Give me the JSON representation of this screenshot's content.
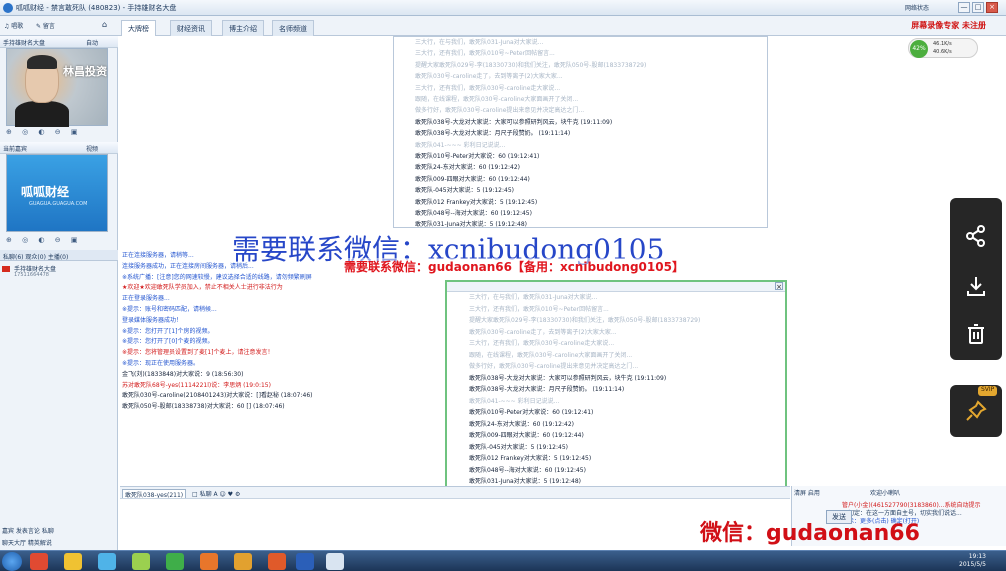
{
  "window": {
    "title": "呱呱财经 - 禁言敢死队 (480823) - 手持雄财名大盘",
    "status_right": "网络状态",
    "minimize": "—",
    "maximize": "□",
    "close": "×"
  },
  "toolbar": {
    "left_items": [
      "♫ 唱歌",
      "✎ 留言",
      "⌂"
    ],
    "tabs": [
      "大牌榜",
      "财经资讯",
      "博主介绍",
      "名师频道"
    ],
    "promo": "屏幕录像专家 未注册"
  },
  "left": {
    "sec1": "手持雄财名大盘",
    "sec1_right": "自动",
    "video1_text": "林昌投资",
    "video2_big": "呱呱财经",
    "video2_small": "GUAGUA.GUAGUA.COM",
    "sec2": "当前嘉宾",
    "sec2_right": "视频",
    "ctrl_row": "⊕ ◎ ◐ ⊖ ▣",
    "userlist_tabs": "私聊(6) 观众(0) 主播(0)",
    "user1": "手持雄财名大盘",
    "user1_sub": "17511664478",
    "bottom1": "嘉宾   发表言论   私聊",
    "bottom2": "聊天大厅   精英解说"
  },
  "chat_top": [
    {
      "text": "三大行，在与我们，敢死队031-Juna对大家说...",
      "faded": true
    },
    {
      "text": "三大行，还有我们，敢死队010号~Peter回帖留言...",
      "faded": true
    },
    {
      "text": "提醒大家敢死队029号-李(18330730)和我们关注，敢死队050号-股邮(1833738729)",
      "faded": true
    },
    {
      "text": "敢死队030号-caroline走了，去到等离子(2)大家大家...",
      "faded": true
    },
    {
      "text": "三大行，还有我们，敢死队030号-caroline走大家说...",
      "faded": true
    },
    {
      "text": "跟随，在线课程，敢死队030号-caroline大家面画开了关闭...",
      "faded": true
    },
    {
      "text": "做多行好，敢死队030号-caroline提出来意见并决定高达之门...",
      "faded": true
    },
    {
      "text": "敢死队038号-大龙对大家说：大家可以参照研判风云，块牛克 (19:11:09)",
      "faded": false
    },
    {
      "text": "敢死队038号-大龙对大家说：月尺子段赞奶。 (19:11:14)",
      "faded": false
    },
    {
      "text": "敢死队041-~~~ 彩利日记说说...",
      "faded": true
    },
    {
      "text": "敢死队010号-Peter对大家说：60 (19:12:41)",
      "faded": false
    },
    {
      "text": "敢死队24-东对大家说：60 (19:12:42)",
      "faded": false
    },
    {
      "text": "敢死队009-四眼对大家说：60 (19:12:44)",
      "faded": false
    },
    {
      "text": "敢死队-045对大家说：5 (19:12:45)",
      "faded": false
    },
    {
      "text": "敢死队012 Frankey对大家说：5 (19:12:45)",
      "faded": false
    },
    {
      "text": "敢死队048号--海对大家说：60 (19:12:45)",
      "faded": false
    },
    {
      "text": "敢死队031-Juna对大家说：5 (19:12:48)",
      "faded": false
    }
  ],
  "chat_mid": [
    {
      "text": "正在连接服务器，请稍等...",
      "cls": "blue"
    },
    {
      "text": "连接服务器成功，正在连接房间服务器，请稍后...",
      "cls": "blue"
    },
    {
      "text": "※系统广播：[注意]您的网速较慢，建议选择合适的线路，请勿频繁刷屏",
      "cls": "blue"
    },
    {
      "text": "★欢迎★欢迎敢死队学员加入，禁止不相关人士进行非法行为",
      "cls": "red"
    },
    {
      "text": "正在登录服务器...",
      "cls": "blue"
    },
    {
      "text": "※提示：账号和密码匹配，请稍候...",
      "cls": "blue"
    },
    {
      "text": "登录媒体服务器成功！",
      "cls": "blue"
    },
    {
      "text": "※提示：您打开了[1]个房的视频。",
      "cls": "blue"
    },
    {
      "text": "※提示：您打开了[0]个麦的视频。",
      "cls": "blue"
    },
    {
      "text": "※提示：您将管理员设置到了麦[1]个麦上，请注意发言！",
      "cls": "red"
    },
    {
      "text": "※提示：现正在使用服务器。",
      "cls": "blue"
    },
    {
      "text": "金飞(刘)(1833848)对大家说：9 (18:56:30)",
      "cls": "dark"
    },
    {
      "text": "苏对敢死队68号-yes(1114221l)说：李思炳 (19:0:15)",
      "cls": "red"
    },
    {
      "text": "敢死队030号-caroline(2108401243)对大家说：[]看赵秘 (18:07:46)",
      "cls": "dark"
    },
    {
      "text": "敢死队050号-股邮(18338738)对大家说：60 [] (18:07:46)",
      "cls": "dark"
    }
  ],
  "watermarks": {
    "blue": "需要联系微信：xcnibudong0105",
    "red_banner": "需要联系微信：gudaonan66【备用：xcnibudong0105】",
    "bottom_right": "微信：gudaonan66"
  },
  "input_bar": {
    "target": "敢死队038-yes(211)",
    "options": "□ 私聊   A  ☺  ♥  ⚙",
    "right": "清屏   启用"
  },
  "send_button": "发送",
  "speed": {
    "pct": "42%",
    "up": "46.1K/s",
    "down": "40.6K/s"
  },
  "right_lower": {
    "title": "欢迎小喇叭",
    "line1": "管户(小金)(461527790(3183860)...系统自动提示",
    "line2": "入切定：在这一方面自主号，切实我们说话...",
    "line3": "显示：更多(点击)  确定(打开)"
  },
  "float_icons": [
    "share-icon",
    "download-icon",
    "trash-icon",
    "pin-icon"
  ],
  "svip": "SVIP",
  "clock": {
    "time": "19:13",
    "date": "2015/5/5"
  }
}
